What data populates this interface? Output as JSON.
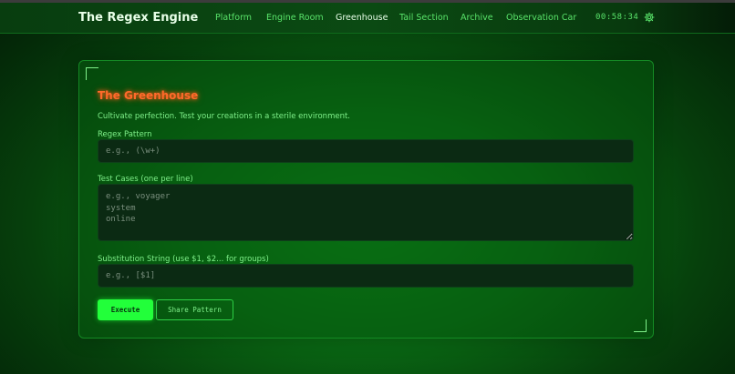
{
  "nav": {
    "brand": "The Regex Engine",
    "links": [
      "Platform",
      "Engine Room",
      "Greenhouse",
      "Tail Section",
      "Archive",
      "Observation Car"
    ],
    "active": "Greenhouse",
    "clock": "00:58:34",
    "settings_icon": "gear-icon"
  },
  "panel": {
    "title": "The Greenhouse",
    "subtitle": "Cultivate perfection. Test your creations in a sterile environment.",
    "pattern_label": "Regex Pattern",
    "pattern_placeholder": "e.g., (\\w+)",
    "tests_label": "Test Cases (one per line)",
    "tests_placeholder": "e.g., voyager\nsystem\nonline",
    "subst_label": "Substitution String (use $1, $2... for groups)",
    "subst_placeholder": "e.g., [$1]",
    "execute_label": "Execute",
    "share_label": "Share Pattern"
  },
  "colors": {
    "accent": "#22ff3a",
    "title": "#ff6a2a",
    "text": "#7ff08a"
  }
}
